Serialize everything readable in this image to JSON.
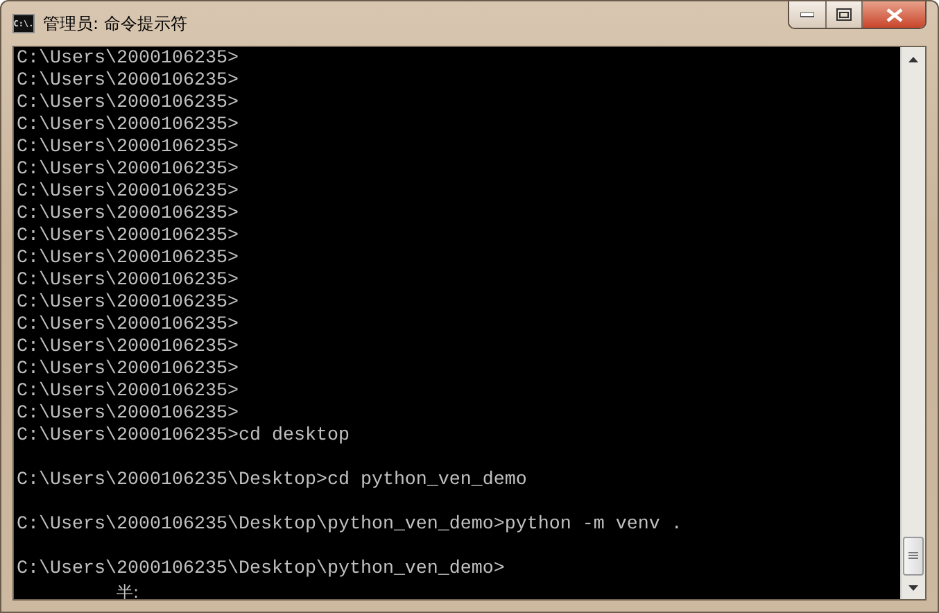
{
  "window": {
    "title": "管理员: 命令提示符",
    "icon_text": "C:\\."
  },
  "console": {
    "blocks": [
      {
        "lines": [
          "C:\\Users\\2000106235>",
          "C:\\Users\\2000106235>",
          "C:\\Users\\2000106235>",
          "C:\\Users\\2000106235>",
          "C:\\Users\\2000106235>",
          "C:\\Users\\2000106235>",
          "C:\\Users\\2000106235>",
          "C:\\Users\\2000106235>",
          "C:\\Users\\2000106235>",
          "C:\\Users\\2000106235>",
          "C:\\Users\\2000106235>",
          "C:\\Users\\2000106235>",
          "C:\\Users\\2000106235>",
          "C:\\Users\\2000106235>",
          "C:\\Users\\2000106235>",
          "C:\\Users\\2000106235>",
          "C:\\Users\\2000106235>",
          "C:\\Users\\2000106235>cd desktop"
        ]
      },
      {
        "lines": [
          "C:\\Users\\2000106235\\Desktop>cd python_ven_demo"
        ]
      },
      {
        "lines": [
          "C:\\Users\\2000106235\\Desktop\\python_ven_demo>python -m venv ."
        ]
      },
      {
        "lines": [
          "C:\\Users\\2000106235\\Desktop\\python_ven_demo>"
        ]
      }
    ],
    "ime_status": "半:"
  }
}
